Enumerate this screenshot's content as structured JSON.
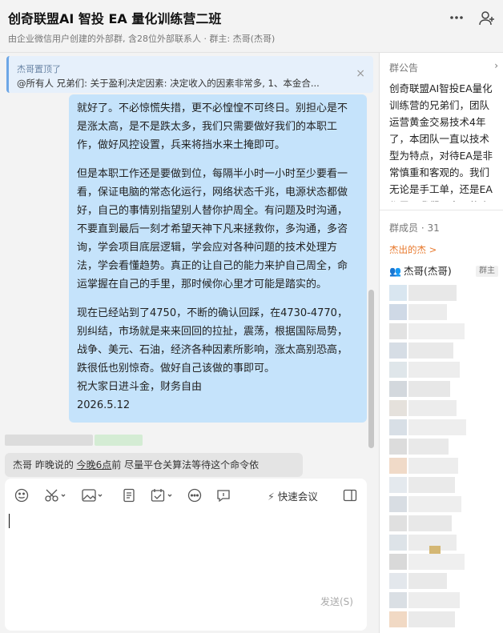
{
  "header": {
    "title": "创奇联盟AI 智投 EA 量化训练营二班",
    "subtitle": "由企业微信用户创建的外部群, 含28位外部联系人 · 群主: 杰哥(杰哥)",
    "more_icon": "more-dots-icon",
    "add_member_icon": "add-person-icon"
  },
  "pin": {
    "who": "杰哥置顶了",
    "text": "@所有人 兄弟们:  关于盈利决定因素: 决定收入的因素非常多, 1、本金合...",
    "close": "×"
  },
  "message": {
    "paragraphs": [
      "就好了。不必惊慌失措，更不必惶惶不可终日。别担心是不是涨太高，是不是跌太多，我们只需要做好我们的本职工作，做好风控设置，兵来将挡水来土掩即可。",
      "但是本职工作还是要做到位，每隔半小时一小时至少要看一看，保证电脑的常态化运行，网络状态千兆，电源状态都做好，自己的事情别指望别人替你护周全。有问题及时沟通，不要直到最后一刻才希望天神下凡来拯救你，多沟通，多咨询，学会项目底层逻辑，学会应对各种问题的技术处理方法，学会看懂趋势。真正的让自己的能力来护自己周全，命运掌握在自己的手里，那时候你心里才可能是踏实的。",
      "现在已经站到了4750，不断的确认回踩，在4730-4770，别纠结，市场就是来来回回的拉扯，震荡，根据国际局势，战争、美元、石油，经济各种因素所影响，涨太高别恐高，跌很低也别惊奇。做好自己该做的事即可。",
      "祝大家日进斗金，财务自由",
      "2026.5.12"
    ]
  },
  "quote": {
    "prefix": "杰哥   昨晚说的 ",
    "link": "今晚6点",
    "suffix": "前  尽量平仓关算法等待这个命令依"
  },
  "composer": {
    "tools": [
      "emoji-icon",
      "scissors-icon",
      "image-icon",
      "document-icon",
      "calendar-check-icon",
      "more-circle-icon",
      "comment-icon"
    ],
    "meeting_label": "快速会议",
    "send_label": "发送(S)"
  },
  "panel": {
    "announcement_title": "群公告",
    "announcement_body": "创奇联盟AI智投EA量化训练营的兄弟们，团队运营黄金交易技术4年了，本团队一直以技术型为特点，对待EA是非常慎重和客观的。我们无论是手工单，还是EA都需要我们以交易的底",
    "members_title": "群成员 · 31",
    "members_link": "杰出的杰 >",
    "owner_name": "杰哥(杰哥)",
    "owner_badge": "群主"
  },
  "colors": {
    "bubble": "#c5e3fb",
    "accent_orange": "#e8792d",
    "pin_bg": "#e6f0fb"
  }
}
